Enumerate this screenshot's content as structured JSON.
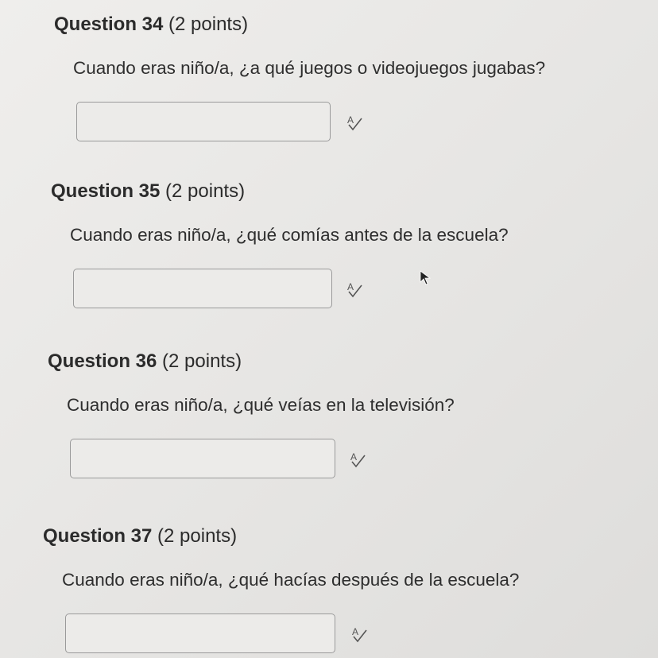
{
  "questions": [
    {
      "number_label": "Question 34",
      "points_label": "(2 points)",
      "prompt": "Cuando eras niño/a, ¿a qué juegos o videojuegos jugabas?",
      "answer_value": "",
      "spellcheck_icon": "spellcheck-icon"
    },
    {
      "number_label": "Question 35",
      "points_label": "(2 points)",
      "prompt": "Cuando eras niño/a, ¿qué comías antes de la escuela?",
      "answer_value": "",
      "spellcheck_icon": "spellcheck-icon"
    },
    {
      "number_label": "Question 36",
      "points_label": "(2 points)",
      "prompt": "Cuando eras niño/a, ¿qué veías en la televisión?",
      "answer_value": "",
      "spellcheck_icon": "spellcheck-icon"
    },
    {
      "number_label": "Question 37",
      "points_label": "(2 points)",
      "prompt": "Cuando eras niño/a, ¿qué hacías después de la escuela?",
      "answer_value": "",
      "spellcheck_icon": "spellcheck-icon"
    }
  ],
  "cursor_icon": "mouse-pointer-icon",
  "colors": {
    "background": "#e9e8e6",
    "text": "#2b2b2b",
    "input_border": "#9a9a9a"
  }
}
